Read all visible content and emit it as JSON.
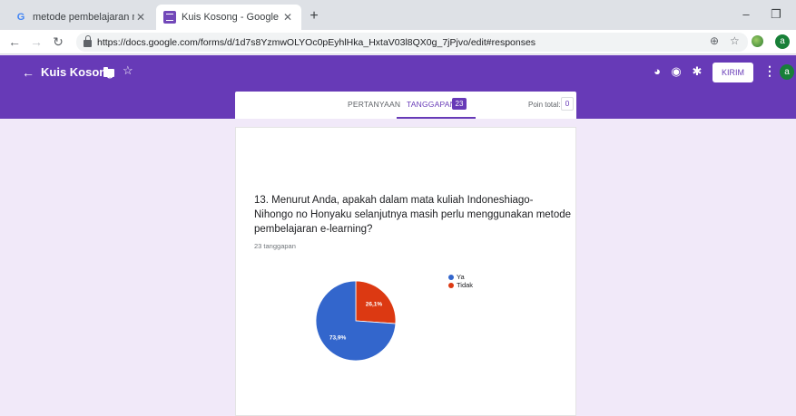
{
  "browser": {
    "tabs": [
      {
        "title": "metode pembelajaran menurut P",
        "icon": "google-g-icon"
      },
      {
        "title": "Kuis Kosong - Google Formulir",
        "icon": "google-forms-icon"
      }
    ],
    "new_tab": "+",
    "url": "https://docs.google.com/forms/d/1d7s8YzmwOLYOc0pEyhlHka_HxtaV03l8QX0g_7jPjvo/edit#responses"
  },
  "header": {
    "title": "Kuis Kosong",
    "send_label": "KIRIM",
    "avatar_letter": "a",
    "brand_color": "#673ab7"
  },
  "form_tabs": {
    "questions_label": "PERTANYAAN",
    "responses_label": "TANGGAPAN",
    "responses_count": "23",
    "points_label": "Poin total:",
    "points_value": "0"
  },
  "summary": {
    "question": "13. Menurut Anda, apakah dalam mata kuliah Indoneshiago-Nihongo no Honyaku selanjutnya masih perlu menggunakan metode pembelajaran e-learning?",
    "response_count_text": "23 tanggapan"
  },
  "chart_data": {
    "type": "pie",
    "categories": [
      "Ya",
      "Tidak"
    ],
    "values": [
      73.9,
      26.1
    ],
    "labels": [
      "73,9%",
      "26,1%"
    ],
    "colors": [
      "#3366cc",
      "#dc3912"
    ],
    "legend_position": "right"
  }
}
